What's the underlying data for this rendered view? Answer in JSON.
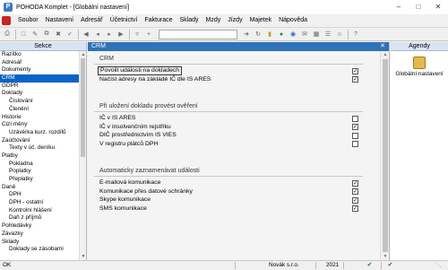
{
  "window": {
    "title": "POHODA Komplet - [Globální nastavení]"
  },
  "menu": [
    "Soubor",
    "Nastavení",
    "Adresář",
    "Účetnictví",
    "Fakturace",
    "Sklady",
    "Mzdy",
    "Jízdy",
    "Majetek",
    "Nápověda"
  ],
  "left_panel": {
    "header": "Sekce",
    "items": [
      {
        "label": "Razítko",
        "sub": false,
        "selected": false
      },
      {
        "label": "Adresář",
        "sub": false,
        "selected": false
      },
      {
        "label": "Dokumenty",
        "sub": false,
        "selected": false
      },
      {
        "label": "CRM",
        "sub": false,
        "selected": true
      },
      {
        "label": "GDPR",
        "sub": false,
        "selected": false
      },
      {
        "label": "Doklady",
        "sub": false,
        "selected": false
      },
      {
        "label": "Číslování",
        "sub": true,
        "selected": false
      },
      {
        "label": "Členění",
        "sub": true,
        "selected": false
      },
      {
        "label": "Historie",
        "sub": false,
        "selected": false
      },
      {
        "label": "Cizí měny",
        "sub": false,
        "selected": false
      },
      {
        "label": "Uzávěrka kurz. rozdílů",
        "sub": true,
        "selected": false
      },
      {
        "label": "Zaúčtování",
        "sub": false,
        "selected": false
      },
      {
        "label": "Texty v úč. deníku",
        "sub": true,
        "selected": false
      },
      {
        "label": "Platby",
        "sub": false,
        "selected": false
      },
      {
        "label": "Pokladna",
        "sub": true,
        "selected": false
      },
      {
        "label": "Poplatky",
        "sub": true,
        "selected": false
      },
      {
        "label": "Přeplatky",
        "sub": true,
        "selected": false
      },
      {
        "label": "Daně",
        "sub": false,
        "selected": false
      },
      {
        "label": "DPH",
        "sub": true,
        "selected": false
      },
      {
        "label": "DPH - ostatní",
        "sub": true,
        "selected": false
      },
      {
        "label": "Kontrolní hlášení",
        "sub": true,
        "selected": false
      },
      {
        "label": "Daň z příjmů",
        "sub": true,
        "selected": false
      },
      {
        "label": "Pohledávky",
        "sub": false,
        "selected": false
      },
      {
        "label": "Závazky",
        "sub": false,
        "selected": false
      },
      {
        "label": "Sklady",
        "sub": false,
        "selected": false
      },
      {
        "label": "Doklady se zásobami",
        "sub": true,
        "selected": false
      }
    ]
  },
  "main": {
    "header": "CRM",
    "groups": [
      {
        "title": "CRM",
        "rows": [
          {
            "label": "Povolit události na dokladech",
            "checked": true,
            "boxed": true
          },
          {
            "label": "Načíst adresy na základě IČ dle IS ARES",
            "checked": true,
            "boxed": false
          }
        ]
      },
      {
        "title": "Při uložení dokladu provést ověření",
        "rows": [
          {
            "label": "IČ v IS ARES",
            "checked": false,
            "boxed": false
          },
          {
            "label": "IČ v insolvenčním rejstříku",
            "checked": true,
            "boxed": false
          },
          {
            "label": "DIČ prostřednictvím IS VIES",
            "checked": false,
            "boxed": false
          },
          {
            "label": "V registru plátců DPH",
            "checked": false,
            "boxed": false
          }
        ]
      },
      {
        "title": "Automaticky zaznamenávat události",
        "rows": [
          {
            "label": "E-mailová komunikace",
            "checked": true,
            "boxed": false
          },
          {
            "label": "Komunikace přes datové schránky",
            "checked": true,
            "boxed": false
          },
          {
            "label": "Skype komunikace",
            "checked": true,
            "boxed": false
          },
          {
            "label": "SMS komunikace",
            "checked": true,
            "boxed": false
          }
        ]
      }
    ]
  },
  "right_panel": {
    "header": "Agendy",
    "item": "Globální nastavení"
  },
  "status": {
    "left": "OK",
    "company": "Novák s.r.o.",
    "year": "2021"
  },
  "colors": {
    "selection": "#0a64c8",
    "main_header": "#2f73b8",
    "panel_header": "#d9e4f2"
  }
}
